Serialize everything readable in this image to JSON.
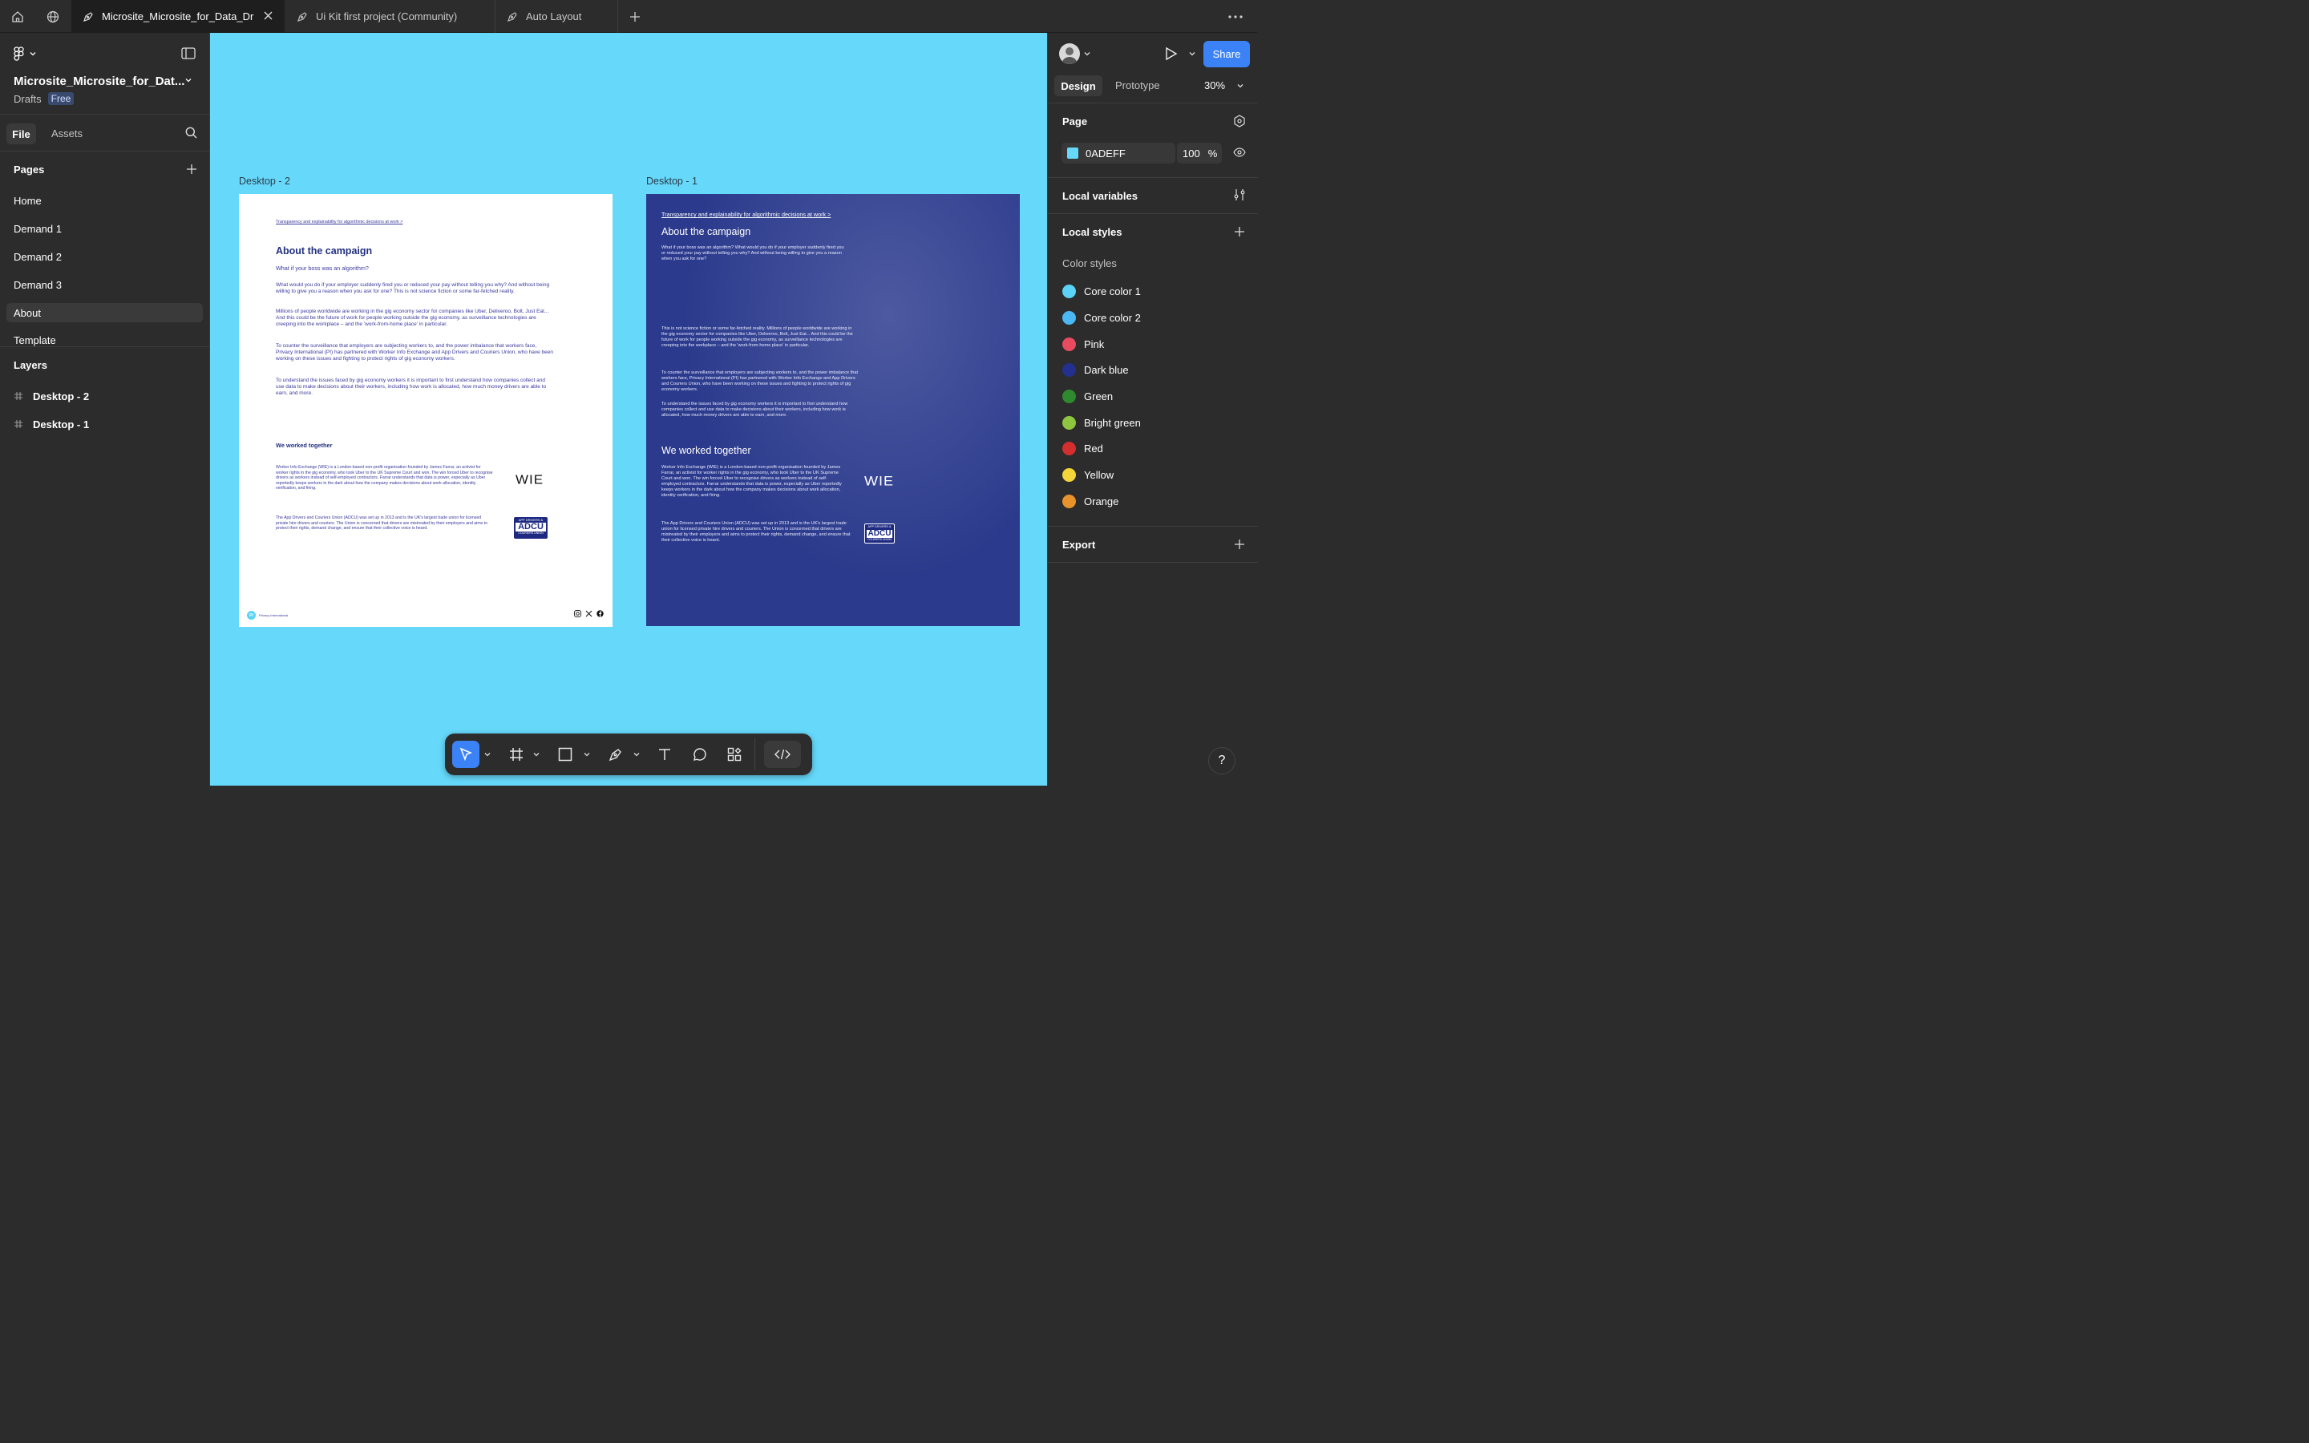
{
  "tabs": [
    {
      "label": "Microsite_Microsite_for_Data_Dri",
      "active": true
    },
    {
      "label": "Ui Kit first project (Community)",
      "active": false
    },
    {
      "label": "Auto Layout",
      "active": false
    }
  ],
  "file": {
    "name": "Microsite_Microsite_for_Dat...",
    "location": "Drafts",
    "plan": "Free"
  },
  "left_tabs": {
    "file": "File",
    "assets": "Assets"
  },
  "pages": {
    "title": "Pages",
    "items": [
      "Home",
      "Demand 1",
      "Demand 2",
      "Demand 3",
      "About",
      "Template"
    ],
    "selected": "About"
  },
  "layers": {
    "title": "Layers",
    "items": [
      "Desktop - 2",
      "Desktop - 1"
    ]
  },
  "canvas": {
    "bg_color": "#66d9fb"
  },
  "frame2": {
    "label": "Desktop - 2",
    "breadcrumb": "Transparency and explainability for algorithmic decisions at work >",
    "heading": "About the campaign",
    "subheading": "What if your boss was an algorithm?",
    "p1": "What would you do if your employer suddenly fired you or reduced your pay without telling you why? And without being willing to give you a reason when you ask for one? This is not science fiction or some far-fetched reality.",
    "p2": "Millions of people worldwide are working in the gig economy sector for companies like Uber, Deliveroo, Bolt, Just Eat... And this could be the future of work for people working outside the gig economy, as surveillance technologies are creeping into the workplace – and the 'work-from-home place' in particular.",
    "p3": "To counter the surveillance that employers are subjecting workers to, and the power imbalance that workers face, Privacy International (PI) has partnered with Worker Info Exchange and App Drivers and Couriers Union, who have been working on these issues and fighting to protect rights of gig economy workers.",
    "p4": "To understand the issues faced by gig economy workers it is important to first understand how companies collect and use data to make decisions about their workers, including how work is allocated, how much money drivers are able to earn, and more.",
    "worked": "We worked together",
    "wie_text": "Worker Info Exchange (WIE) is a London-based non-profit organisation founded by James Farrar, an activist for worker rights in the gig economy, who took Uber to the UK Supreme Court and won. The win forced Uber to recognise drivers as workers instead of self-employed contractors. Farrar understands that data is power, especially as Uber reportedly keeps workers in the dark about how the company makes decisions about work allocation, identity verification, and firing.",
    "wie_logo": "WIE",
    "adcu_text": "The App Drivers and Couriers Union (ADCU) was set up in 2013 and is the UK's largest trade union for licensed private hire drivers and couriers. The Union is concerned that drivers are mistreated by their employers and aims to protect their rights, demand change, and ensure that their collective voice is heard.",
    "adcu_logo_top": "APP DRIVERS &",
    "adcu_logo_mid": "ADCU",
    "adcu_logo_bot": "COURIERS UNION",
    "footer_org": "Privacy International",
    "footer_badge": "PI"
  },
  "frame1": {
    "label": "Desktop - 1",
    "breadcrumb": "Transparency and explainability for algorithmic decisions at work >",
    "heading": "About the campaign",
    "intro": "What if your boss was an algorithm? What would you do if your employer suddenly fired you or reduced your pay without telling you why? And without being willing to give you a reason when you ask for one?",
    "p1": "This is not science fiction or some far-fetched reality. Millions of people worldwide are working in the gig economy sector for companies like Uber, Deliveroo, Bolt, Just Eat... And this could be the future of work for people working outside the gig economy, as surveillance technologies are creeping into the workplace – and the 'work-from-home place' in particular.",
    "p2": "To counter the surveillance that employers are subjecting workers to, and the power imbalance that workers face, Privacy International (PI) has partnered with Worker Info Exchange and App Drivers and Couriers Union, who have been working on these issues and fighting to protect rights of gig economy workers.",
    "p3": "To understand the issues faced by gig economy workers it is important to first understand how companies collect and use data to make decisions about their workers, including how work is allocated, how much money drivers are able to earn, and more.",
    "worked": "We worked together",
    "wie_text": "Worker Info Exchange (WIE) is a London-based non-profit organisation founded by James Farrar, an activist for worker rights in the gig economy, who took Uber to the UK Supreme Court and won. The win forced Uber to recognise drivers as workers instead of self-employed contractors. Farrar understands that data is power, especially as Uber reportedly keeps workers in the dark about how the company makes decisions about work allocation, identity verification, and firing.",
    "wie_logo": "WIE",
    "adcu_text": "The App Drivers and Couriers Union (ADCU) was set up in 2013 and is the UK's largest trade union for licensed private hire drivers and couriers. The Union is concerned that drivers are mistreated by their employers and aims to protect their rights, demand change, and ensure that their collective voice is heard.",
    "adcu_logo_top": "APP DRIVERS &",
    "adcu_logo_mid": "ADCU",
    "adcu_logo_bot": "COURIERS UNION"
  },
  "right": {
    "tabs": {
      "design": "Design",
      "prototype": "Prototype"
    },
    "zoom": "30%",
    "share": "Share",
    "page_title": "Page",
    "page_color_hex": "0ADEFF",
    "page_opacity": "100",
    "percent": "%",
    "local_variables": "Local variables",
    "local_styles": "Local styles",
    "color_styles_title": "Color styles",
    "color_styles": [
      {
        "name": "Core color 1",
        "color": "#5ad3f7"
      },
      {
        "name": "Core color 2",
        "color": "#4ab8f5"
      },
      {
        "name": "Pink",
        "color": "#e84b5f"
      },
      {
        "name": "Dark blue",
        "color": "#23308f"
      },
      {
        "name": "Green",
        "color": "#2f8a2f"
      },
      {
        "name": "Bright green",
        "color": "#8ec63f"
      },
      {
        "name": "Red",
        "color": "#d42e2e"
      },
      {
        "name": "Yellow",
        "color": "#f5d63a"
      },
      {
        "name": "Orange",
        "color": "#e8922c"
      }
    ],
    "export": "Export"
  },
  "help": "?"
}
